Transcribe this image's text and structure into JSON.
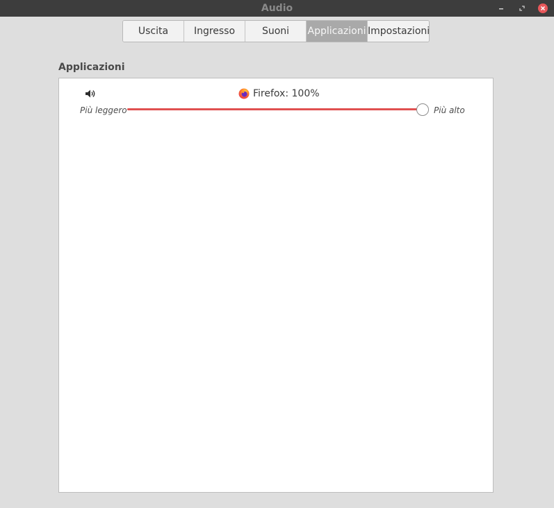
{
  "window": {
    "title": "Audio"
  },
  "tabs": [
    {
      "label": "Uscita",
      "active": false
    },
    {
      "label": "Ingresso",
      "active": false
    },
    {
      "label": "Suoni",
      "active": false
    },
    {
      "label": "Applicazioni",
      "active": true
    },
    {
      "label": "Impostazioni",
      "active": false
    }
  ],
  "section": {
    "title": "Applicazioni"
  },
  "apps": [
    {
      "label": "Firefox: 100%",
      "icon": "firefox-icon",
      "volume_percent": 100,
      "slider_min_label": "Più leggero",
      "slider_max_label": "Più alto"
    }
  ],
  "colors": {
    "slider_fill": "#e05050",
    "active_tab": "#a9a9a9",
    "titlebar": "#3d3d3d",
    "close_button": "#e8575a"
  }
}
